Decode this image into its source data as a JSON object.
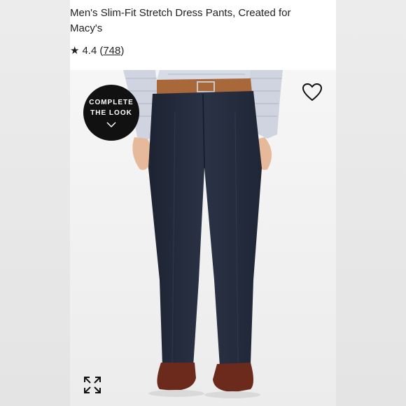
{
  "product": {
    "title": "Men's Slim-Fit Stretch Dress Pants, Created for Macy's",
    "rating": {
      "star": "★",
      "value": "4.4",
      "count_open": "(",
      "count": "748",
      "count_close": ")"
    }
  },
  "image": {
    "badge": {
      "line1": "COMPLETE",
      "line2": "THE LOOK",
      "icon": "chevron-down-icon"
    },
    "wishlist_icon": "heart-icon",
    "expand_icon": "expand-icon"
  },
  "colors": {
    "pants": "#252c3d",
    "belt": "#a9683a",
    "shoes": "#6b2a1c",
    "badge": "#111111"
  }
}
